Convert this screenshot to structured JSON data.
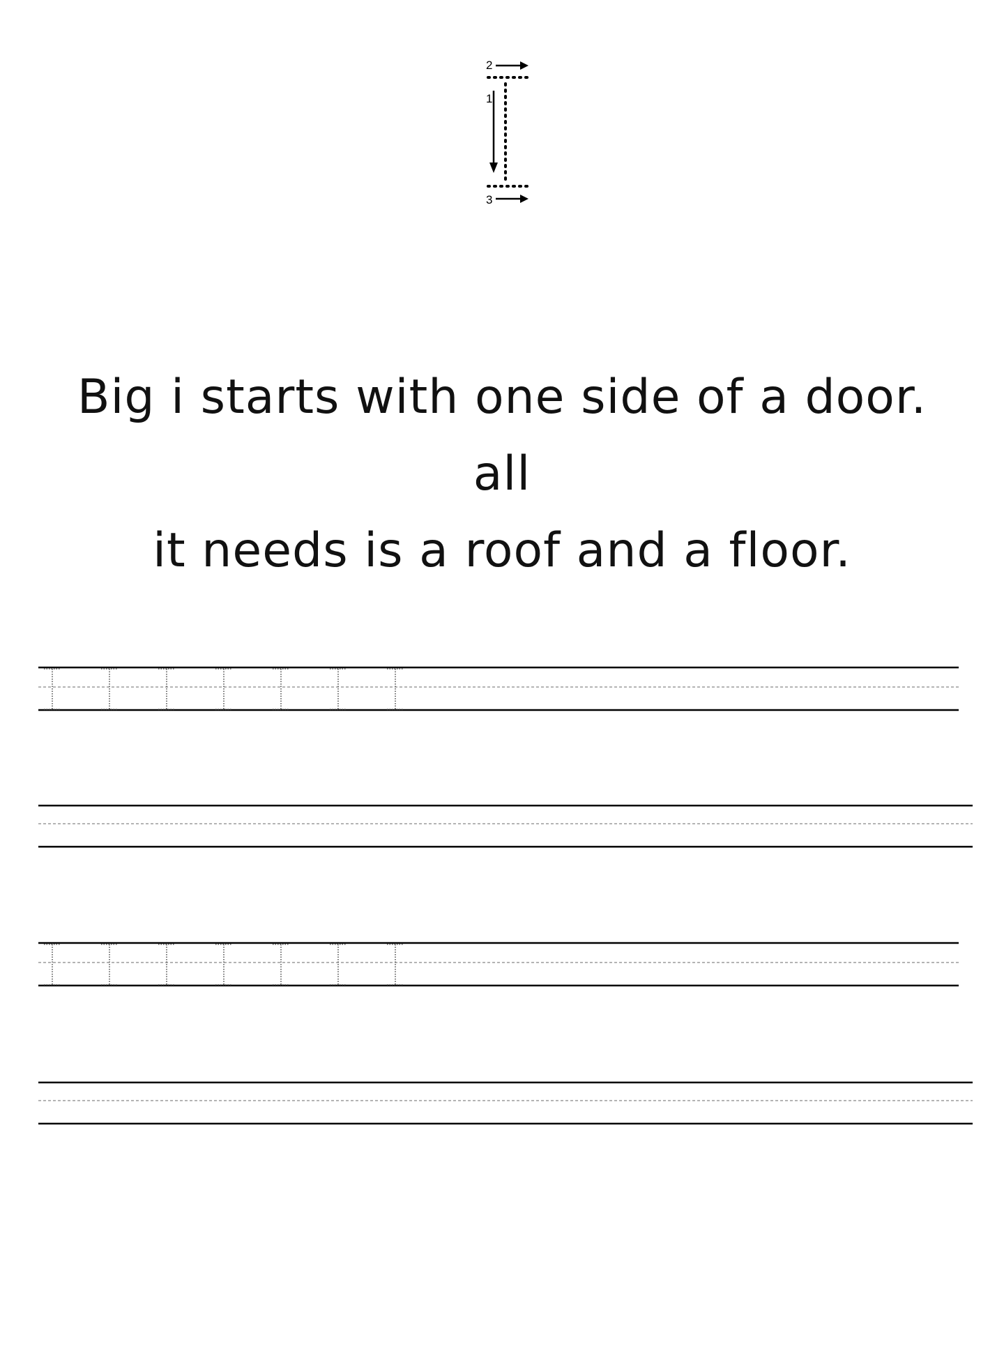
{
  "stroke_guide": {
    "step_numbers": [
      "1",
      "2",
      "3"
    ],
    "letter": "I"
  },
  "rhyme": {
    "line1": "Big i starts with one side of a door. all",
    "line2": "it needs is a roof and a floor."
  },
  "practice_rows": [
    {
      "type": "tracing",
      "trace_count": 7
    },
    {
      "type": "blank"
    },
    {
      "type": "tracing",
      "trace_count": 7
    },
    {
      "type": "blank"
    }
  ]
}
